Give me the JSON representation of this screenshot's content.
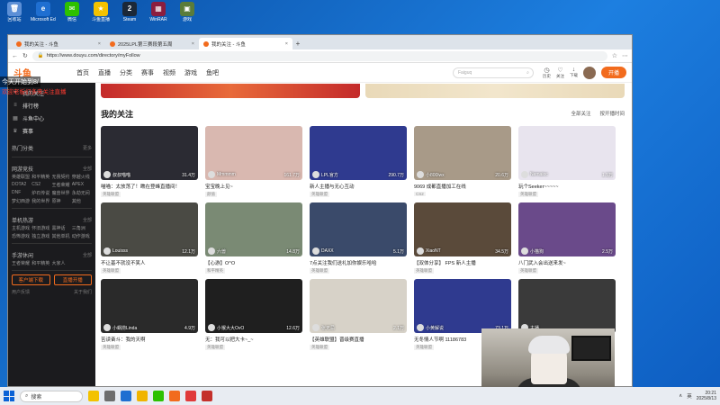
{
  "desktop": {
    "icons": [
      {
        "label": "回收站",
        "color": "#5c8fd6",
        "glyph": "🗑"
      },
      {
        "label": "Microsoft Edge",
        "color": "#1f6fd1",
        "glyph": "e"
      },
      {
        "label": "微信",
        "color": "#2dc100",
        "glyph": "✉"
      },
      {
        "label": "斗鱼直播",
        "color": "#f3c200",
        "glyph": "★"
      },
      {
        "label": "Steam",
        "color": "#1b2838",
        "glyph": "2"
      },
      {
        "label": "WinRAR",
        "color": "#8b1e3f",
        "glyph": "▦"
      },
      {
        "label": "游戏",
        "color": "#5a7c3a",
        "glyph": "▣"
      }
    ]
  },
  "browser": {
    "tabs": [
      {
        "title": "我的关注 - 斗鱼",
        "active": false
      },
      {
        "title": "2025LPL第三赛段第五周",
        "active": false
      },
      {
        "title": "我的关注 - 斗鱼",
        "active": true
      }
    ],
    "url": "https://www.douyu.com/directory/myFollow"
  },
  "site": {
    "logo": "斗鱼",
    "nav": [
      "首页",
      "直播",
      "分类",
      "赛事",
      "视频",
      "游戏",
      "鱼吧"
    ],
    "search_placeholder": "Faiguq",
    "top_icons": [
      "历史",
      "关注",
      "下载",
      "开播"
    ],
    "open_button": "开播"
  },
  "sidebar": {
    "items": [
      {
        "label": "我的关注",
        "icon": "heart"
      },
      {
        "label": "排行榜",
        "icon": "list"
      },
      {
        "label": "斗鱼中心",
        "icon": "grid"
      },
      {
        "label": "赛事",
        "icon": "trophy"
      }
    ],
    "sections": [
      {
        "title": "热门分类",
        "more": "更多",
        "items": []
      },
      {
        "title": "网游竞技",
        "more": "全部",
        "items": [
          "英雄联盟",
          "和平精英",
          "无畏契约",
          "穿越火线",
          "DOTA2",
          "CS2",
          "王者荣耀",
          "APEX",
          "DNF",
          "炉石传说",
          "魔兽世界",
          "永劫无间",
          "梦幻西游",
          "我的世界",
          "原神",
          "其他"
        ]
      },
      {
        "title": "单机热游",
        "more": "全部",
        "items": [
          "主机游戏",
          "怀旧游戏",
          "黑神话",
          "三角洲",
          "恐怖游戏",
          "独立游戏",
          "其他单机",
          "动作游戏"
        ]
      },
      {
        "title": "手游休闲",
        "more": "全部",
        "items": [
          "王者荣耀",
          "和平精英",
          "大家人"
        ]
      }
    ],
    "actions": [
      "客户端下载",
      "直播开播"
    ],
    "footer": [
      "用户反馈",
      "关于我们"
    ]
  },
  "overlay": {
    "line1": "今天开始到8/",
    "line2": "欢迎老板们多来关注直播"
  },
  "main": {
    "title": "我的关注",
    "sort": [
      "全部关注",
      "按开播时间"
    ],
    "cards": [
      {
        "anchor": "叔叔喵喵",
        "viewers": "31.4万",
        "title": "喵喵：太放荡了！瞧在登峰直播间！",
        "tag": "英雄联盟",
        "bg": "#2b2b33"
      },
      {
        "anchor": "Mmmmm",
        "viewers": "161.7万",
        "title": "宝宝晚上见~",
        "tag": "颜值",
        "bg": "#d9b8b0"
      },
      {
        "anchor": "LPL官方",
        "viewers": "290.7万",
        "title": "新人主播与无心互动",
        "tag": "英雄联盟",
        "bg": "#2f3a8f"
      },
      {
        "anchor": "小800lwx",
        "viewers": "20.6万",
        "title": "9069 成都直播加工在线",
        "tag": "CS2",
        "bg": "#a89a88"
      },
      {
        "anchor": "Nemaioc",
        "viewers": "1.5万",
        "title": "玩个Seeker~~~~~",
        "tag": "英雄联盟",
        "bg": "#e8e4ee"
      },
      {
        "anchor": "Louisss",
        "viewers": "12.1万",
        "title": "不让基不就没不笑人",
        "tag": "英雄联盟",
        "bg": "#4a4a44"
      },
      {
        "anchor": "六兽",
        "viewers": "14.8万",
        "title": "【心游】O^O",
        "tag": "和平精英",
        "bg": "#7a8a74"
      },
      {
        "anchor": "DAXX",
        "viewers": "5.1万",
        "title": "7点关注我们送礼加你娱乐哈哈",
        "tag": "英雄联盟",
        "bg": "#3a4a6a"
      },
      {
        "anchor": "XiaoNT",
        "viewers": "34.5万",
        "title": "【双体分享】 FPS 新人主播",
        "tag": "英雄联盟",
        "bg": "#5a4a3a"
      },
      {
        "anchor": "小猫狗",
        "viewers": "2.5万",
        "title": "八门武入会出送来发~",
        "tag": "英雄联盟",
        "bg": "#6a4a8a"
      },
      {
        "anchor": "小蜗捞Linda",
        "viewers": "4.9万",
        "title": "苦读奋斗：我的天啊",
        "tag": "英雄联盟",
        "bg": "#2a2a2a"
      },
      {
        "anchor": "小猴大大OvO",
        "viewers": "12.6万",
        "title": "无：我可以把大卡~_~",
        "tag": "英雄联盟",
        "bg": "#1f1f1f"
      },
      {
        "anchor": "张无忌",
        "viewers": "2.1万",
        "title": "【英雄联盟】晋级赛直播",
        "tag": "英雄联盟",
        "bg": "#d7d2c8"
      },
      {
        "anchor": "小黄解说",
        "viewers": "73.1万",
        "title": "无冬情人节啊 11186783",
        "tag": "英雄联盟",
        "bg": "#2f3a8f"
      },
      {
        "anchor": "主播",
        "viewers": "",
        "title": "",
        "tag": "",
        "bg": "#3a3a3a"
      }
    ]
  },
  "taskbar": {
    "search": "搜索",
    "tray": [
      "∧",
      "英"
    ],
    "time": "20:21",
    "date": "2025/8/13"
  }
}
